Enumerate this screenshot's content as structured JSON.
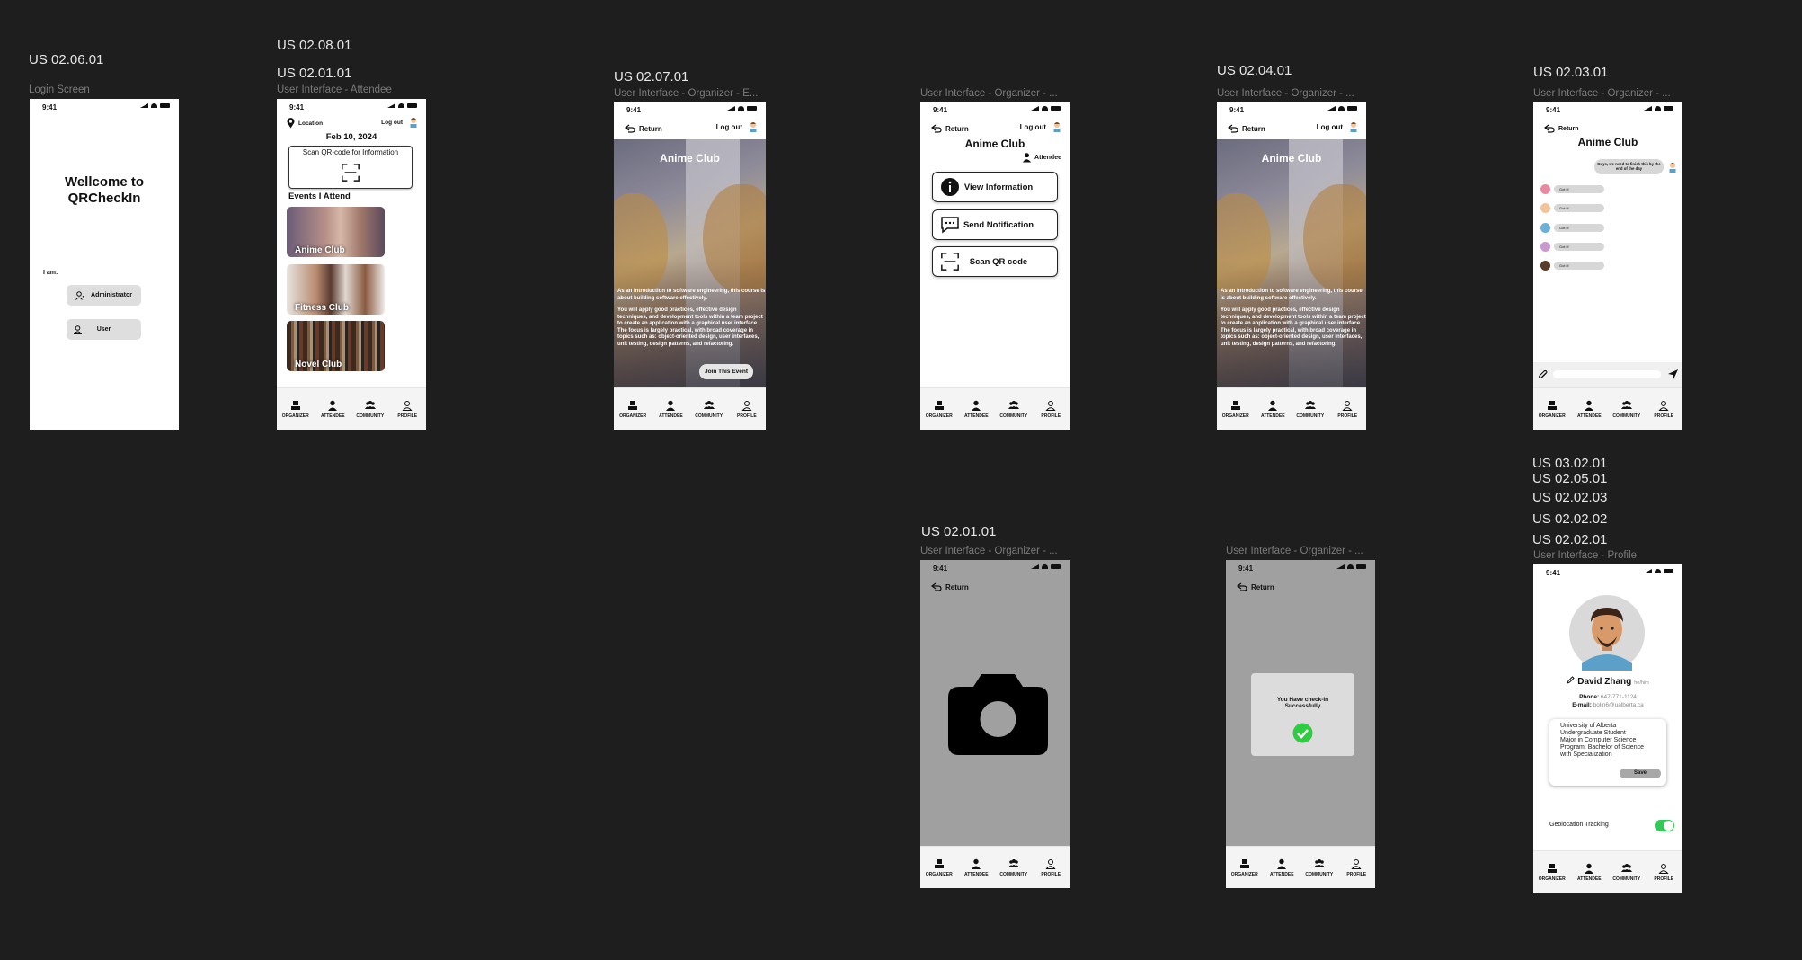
{
  "colors": {
    "canvas": "#1e1e1e",
    "accent_green": "#2ecc40",
    "toggle_green": "#34c759"
  },
  "icons": [
    "signal-icon",
    "wifi-icon",
    "battery-icon",
    "return-icon",
    "avatar-icon",
    "location-pin-icon",
    "qr-scan-icon",
    "organizer-icon",
    "attendee-icon",
    "community-icon",
    "profile-icon",
    "info-icon",
    "chat-icon",
    "camera-icon",
    "checkmark-icon",
    "paperclip-icon",
    "send-icon",
    "pencil-icon",
    "admin-icon",
    "user-icon"
  ],
  "story_tags": {
    "t1": "US 02.06.01",
    "t2a": "US 02.08.01",
    "t2b": "US 02.01.01",
    "t3": "US 02.07.01",
    "t5": "US 02.04.01",
    "t6": "US 02.03.01",
    "t7": "US 02.01.01",
    "t9a": "US 03.02.01",
    "t9b": "US 02.05.01",
    "t9c": "US 02.02.03",
    "t9d": "US 02.02.02",
    "t9e": "US 02.02.01"
  },
  "frame_labels": {
    "f1": "Login Screen",
    "f2": "User Interface - Attendee",
    "f3": "User Interface - Organizer - E...",
    "f4": "User Interface - Organizer - ...",
    "f5": "User Interface - Organizer - ...",
    "f6": "User Interface - Organizer - ...",
    "f7": "User Interface - Organizer - ...",
    "f8": "User Interface - Organizer - ...",
    "f9": "User Interface - Profile"
  },
  "common": {
    "time": "9:41",
    "return": "Return",
    "logout": "Log out",
    "tabs": [
      "ORGANIZER",
      "ATTENDEE",
      "COMMUNITY",
      "PROFILE"
    ]
  },
  "login": {
    "title_line1": "Wellcome to",
    "title_line2": "QRCheckIn",
    "i_am": "I am:",
    "admin_button": "Administrator",
    "user_button": "User"
  },
  "attendee": {
    "location": "Location",
    "date": "Feb 10, 2024",
    "scan_label": "Scan QR-code for Information",
    "events_heading": "Events I Attend",
    "events": [
      "Anime Club",
      "Fitness Club",
      "Novel Club"
    ]
  },
  "event": {
    "title": "Anime Club",
    "desc1": "As an introduction to software engineering, this course is about building software effectively.",
    "desc2": "You will apply good practices, effective design techniques, and development tools within a team project to create an application with a graphical user interface.",
    "desc3": "The focus is largely practical, with broad coverage in topics such as: object-oriented design, user interfaces, unit testing, design patterns, and refactoring.",
    "join": "Join This Event"
  },
  "organizer_menu": {
    "title": "Anime Club",
    "attendee": "Attendee",
    "buttons": [
      "View Information",
      "Send Notification",
      "Scan QR code"
    ]
  },
  "chat": {
    "title": "Anime Club",
    "message": "Guys, we need to finish this by the end of the day",
    "replies": [
      "Got it!",
      "Got it!",
      "Got it!",
      "Got it!",
      "Got it!"
    ]
  },
  "checkin": {
    "message": "You Have check-in Successfully"
  },
  "profile": {
    "name": "David Zhang",
    "pronouns": "he/him",
    "phone_label": "Phone:",
    "phone": "647-771-1124",
    "email_label": "E-mail:",
    "email": "bolin6@ualberta.ca",
    "bio": [
      "University of Alberta",
      "Undergraduate Student",
      "Major in Computer Science",
      "Program: Bachelor of Science",
      "with Specialization"
    ],
    "save": "Save",
    "geo_label": "Geolocation Tracking",
    "geo_enabled": true
  }
}
